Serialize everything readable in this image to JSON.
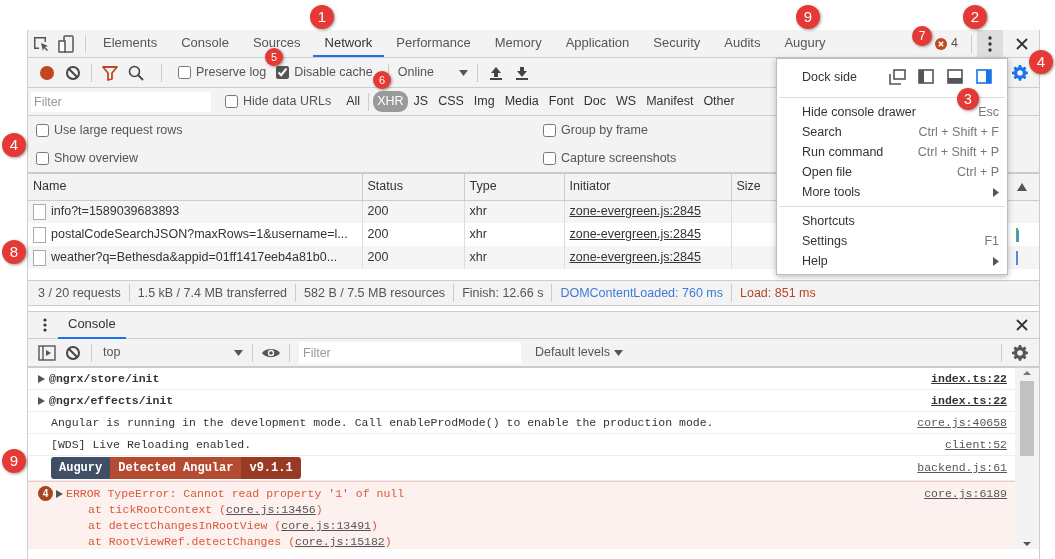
{
  "tabs": [
    {
      "label": "Elements",
      "selected": false
    },
    {
      "label": "Console",
      "selected": false
    },
    {
      "label": "Sources",
      "selected": false
    },
    {
      "label": "Network",
      "selected": true
    },
    {
      "label": "Performance",
      "selected": false
    },
    {
      "label": "Memory",
      "selected": false
    },
    {
      "label": "Application",
      "selected": false
    },
    {
      "label": "Security",
      "selected": false
    },
    {
      "label": "Audits",
      "selected": false
    },
    {
      "label": "Augury",
      "selected": false
    }
  ],
  "error_count": "4",
  "network_toolbar": {
    "preserve_log": {
      "label": "Preserve log",
      "checked": false
    },
    "disable_cache": {
      "label": "Disable cache",
      "checked": true
    },
    "throttling": "Online"
  },
  "filter_bar": {
    "placeholder": "Filter",
    "hide_data_urls": {
      "label": "Hide data URLs",
      "checked": false
    },
    "types": [
      {
        "label": "All",
        "selected": false
      },
      {
        "label": "XHR",
        "selected": true
      },
      {
        "label": "JS",
        "selected": false
      },
      {
        "label": "CSS",
        "selected": false
      },
      {
        "label": "Img",
        "selected": false
      },
      {
        "label": "Media",
        "selected": false
      },
      {
        "label": "Font",
        "selected": false
      },
      {
        "label": "Doc",
        "selected": false
      },
      {
        "label": "WS",
        "selected": false
      },
      {
        "label": "Manifest",
        "selected": false
      },
      {
        "label": "Other",
        "selected": false
      }
    ]
  },
  "settings": [
    {
      "label": "Use large request rows",
      "checked": false
    },
    {
      "label": "Group by frame",
      "checked": false
    },
    {
      "label": "Show overview",
      "checked": false
    },
    {
      "label": "Capture screenshots",
      "checked": false
    }
  ],
  "table": {
    "columns": [
      "Name",
      "Status",
      "Type",
      "Initiator",
      "Size"
    ],
    "rows": [
      {
        "name": "info?t=1589039683893",
        "status": "200",
        "type": "xhr",
        "initiator": "zone-evergreen.js:2845"
      },
      {
        "name": "postalCodeSearchJSON?maxRows=1&username=l...",
        "status": "200",
        "type": "xhr",
        "initiator": "zone-evergreen.js:2845"
      },
      {
        "name": "weather?q=Bethesda&appid=01ff1417eeb4a81b0...",
        "status": "200",
        "type": "xhr",
        "initiator": "zone-evergreen.js:2845"
      }
    ]
  },
  "summary": [
    {
      "kind": "plain",
      "text": "3 / 20 requests"
    },
    {
      "kind": "plain",
      "text": "1.5 kB / 7.4 MB transferred"
    },
    {
      "kind": "plain",
      "text": "582 B / 7.5 MB resources"
    },
    {
      "kind": "plain",
      "text": "Finish: 12.66 s"
    },
    {
      "kind": "dom",
      "text": "DOMContentLoaded: 760 ms"
    },
    {
      "kind": "load",
      "text": "Load: 851 ms"
    }
  ],
  "menu": {
    "dock_label": "Dock side",
    "dock_options": [
      {
        "kind": "undock",
        "selected": false
      },
      {
        "kind": "left",
        "selected": false
      },
      {
        "kind": "bottom",
        "selected": false
      },
      {
        "kind": "right",
        "selected": true
      }
    ],
    "sections": [
      [
        {
          "label": "Hide console drawer",
          "shortcut": "Esc"
        },
        {
          "label": "Search",
          "shortcut": "Ctrl + Shift + F"
        },
        {
          "label": "Run command",
          "shortcut": "Ctrl + Shift + P"
        },
        {
          "label": "Open file",
          "shortcut": "Ctrl + P"
        },
        {
          "label": "More tools",
          "submenu": true
        }
      ],
      [
        {
          "label": "Shortcuts"
        },
        {
          "label": "Settings",
          "shortcut": "F1"
        },
        {
          "label": "Help",
          "submenu": true
        }
      ]
    ]
  },
  "drawer": {
    "tabs": [
      {
        "label": "Console",
        "selected": true
      }
    ],
    "context": "top",
    "filter_placeholder": "Filter",
    "levels": "Default levels"
  },
  "console": [
    {
      "kind": "group",
      "text": "@ngrx/store/init",
      "source": "index.ts:22"
    },
    {
      "kind": "group",
      "text": "@ngrx/effects/init",
      "source": "index.ts:22"
    },
    {
      "kind": "log",
      "text": "Angular is running in the development mode. Call enableProdMode() to enable the production mode.",
      "source": "core.js:40658"
    },
    {
      "kind": "log",
      "text": "[WDS] Live Reloading enabled.",
      "source": "client:52"
    },
    {
      "kind": "badge",
      "parts": [
        {
          "text": "Augury",
          "color": "#3f4f66"
        },
        {
          "text": "Detected Angular",
          "color": "#b54b30"
        },
        {
          "text": "v9.1.1",
          "color": "#993a25"
        }
      ],
      "source": "backend.js:61"
    },
    {
      "kind": "error",
      "count": "4",
      "text": "ERROR TypeError: Cannot read property '1' of null",
      "source": "core.js:6189",
      "stack": [
        {
          "before": "at tickRootContext (",
          "link": "core.js:13456",
          "after": ")"
        },
        {
          "before": "at detectChangesInRootView (",
          "link": "core.js:13491",
          "after": ")"
        },
        {
          "before": "at RootViewRef.detectChanges (",
          "link": "core.js:15182",
          "after": ")"
        }
      ]
    }
  ],
  "callouts": [
    "1",
    "9",
    "7",
    "2",
    "5",
    "3",
    "4",
    "6",
    "4",
    "8",
    "9"
  ]
}
